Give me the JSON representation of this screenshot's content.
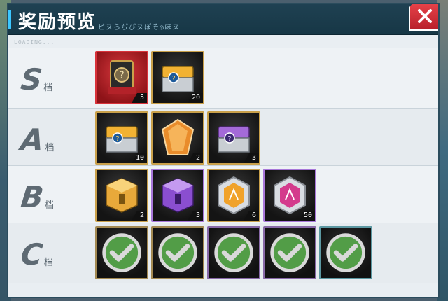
{
  "header": {
    "title": "奖励预览",
    "subtitle": "ビヌらぢびヌぽそ◎ほヌ",
    "close_icon": "close-icon"
  },
  "loading_text": "LOADING...",
  "colors": {
    "header_bg": "#1f4152",
    "accent": "#3cc7ff",
    "close_red": "#d8323a",
    "gold_border": "#c9a04a",
    "check_green": "#4cc23a"
  },
  "tiers": [
    {
      "letter": "S",
      "suffix": "档",
      "items": [
        {
          "icon": "mystery-card-icon",
          "quantity": "5",
          "frame": "red",
          "claimed": false
        },
        {
          "icon": "gold-chest-icon",
          "quantity": "20",
          "frame": "gold",
          "claimed": false
        }
      ]
    },
    {
      "letter": "A",
      "suffix": "档",
      "items": [
        {
          "icon": "gold-chest-icon",
          "quantity": "10",
          "frame": "gold",
          "claimed": false
        },
        {
          "icon": "orange-crystal-icon",
          "quantity": "2",
          "frame": "gold",
          "claimed": false
        },
        {
          "icon": "purple-chest-icon",
          "quantity": "3",
          "frame": "gold",
          "claimed": false
        }
      ]
    },
    {
      "letter": "B",
      "suffix": "档",
      "items": [
        {
          "icon": "gold-cube-icon",
          "quantity": "2",
          "frame": "gold",
          "claimed": false
        },
        {
          "icon": "purple-cube-icon",
          "quantity": "3",
          "frame": "purple",
          "claimed": false
        },
        {
          "icon": "gold-hex-badge-icon",
          "quantity": "6",
          "frame": "gold",
          "claimed": false
        },
        {
          "icon": "pink-hex-badge-icon",
          "quantity": "50",
          "frame": "purple",
          "claimed": false
        }
      ]
    },
    {
      "letter": "C",
      "suffix": "档",
      "items": [
        {
          "icon": "gold-cube-icon",
          "quantity": "",
          "frame": "gold",
          "claimed": true
        },
        {
          "icon": "gold-hex-badge-icon",
          "quantity": "",
          "frame": "gold",
          "claimed": true
        },
        {
          "icon": "purple-cube-icon",
          "quantity": "",
          "frame": "purple",
          "claimed": true
        },
        {
          "icon": "pink-hex-badge-icon",
          "quantity": "",
          "frame": "purple",
          "claimed": true
        },
        {
          "icon": "teal-hex-badge-icon",
          "quantity": "",
          "frame": "teal",
          "claimed": true
        }
      ]
    }
  ]
}
